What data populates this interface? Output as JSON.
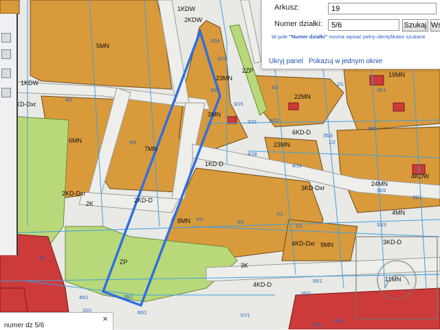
{
  "search_panel": {
    "sheet_label": "Arkusz:",
    "sheet_value": "19",
    "parcel_label": "Numer działki:",
    "parcel_value": "5/6",
    "search_button": "Szukaj",
    "clear_button": "Ws",
    "hint_prefix": "W pole ",
    "hint_bold": "\"Numer działki\"",
    "hint_suffix": " można wpisać pełny identyfikator szukane",
    "hide_link": "Ukryj panel",
    "new_window_link": "Pokazuj w jednym oknie"
  },
  "bottom_popup": {
    "title": "numer dz 5/6",
    "close_icon": "×"
  },
  "map": {
    "colors": {
      "residential": "#d99a3b",
      "green": "#b9d87a",
      "road": "#e9e9e6",
      "service": "#cc3a3a",
      "parcel_line": "#3da0e0",
      "highlight": "#2f6fe0"
    },
    "zone_labels": [
      "5MN",
      "1KDW",
      "1KD-Dxr",
      "6MN",
      "7MN",
      "2KD-Dxr",
      "2K",
      "2KD-D",
      "3MN",
      "1KD-D",
      "8MN",
      "ZP",
      "3K",
      "2ZP",
      "23MN",
      "22MN",
      "19MN",
      "6KD-D",
      "23MN",
      "3KD-Dxr",
      "24MN",
      "4KD-Dxr",
      "9MN",
      "4KD-D",
      "4MN",
      "3KD-D",
      "11MN",
      "2KDW",
      "1KDW",
      "4KDW"
    ],
    "parcel_labels": [
      "4/6",
      "5/6",
      "4/3",
      "3/3",
      "2/1",
      "1/2",
      "3/21",
      "3/22",
      "3/15",
      "3/16",
      "3/23",
      "3/24",
      "4/2",
      "4/16",
      "4/18",
      "36/1",
      "36/2",
      "33/3",
      "33/1",
      "35/1",
      "35/3",
      "1/1",
      "1/2",
      "59/1",
      "60/1",
      "45/1",
      "20/1",
      "55/1",
      "55/2",
      "55/4",
      "57/1",
      "63/1",
      "62"
    ]
  }
}
